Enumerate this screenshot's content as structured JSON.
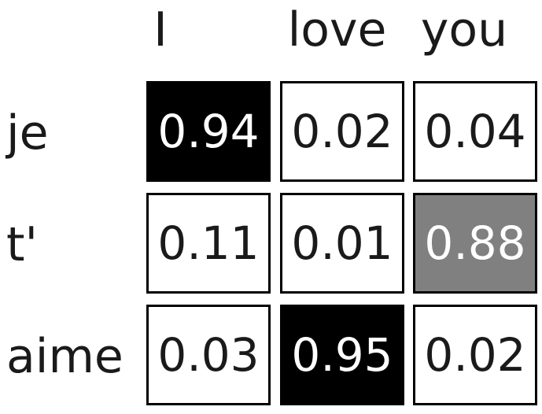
{
  "columns": [
    "I",
    "love",
    "you"
  ],
  "rows": [
    {
      "label": "je",
      "values": [
        "0.94",
        "0.02",
        "0.04"
      ]
    },
    {
      "label": "t'",
      "values": [
        "0.11",
        "0.01",
        "0.88"
      ]
    },
    {
      "label": "aime",
      "values": [
        "0.03",
        "0.95",
        "0.02"
      ]
    }
  ],
  "colors": {
    "high": "#000000",
    "mid": "#808080",
    "low": "#ffffff",
    "text_dark": "#1a1a1a",
    "text_light": "#ffffff"
  }
}
